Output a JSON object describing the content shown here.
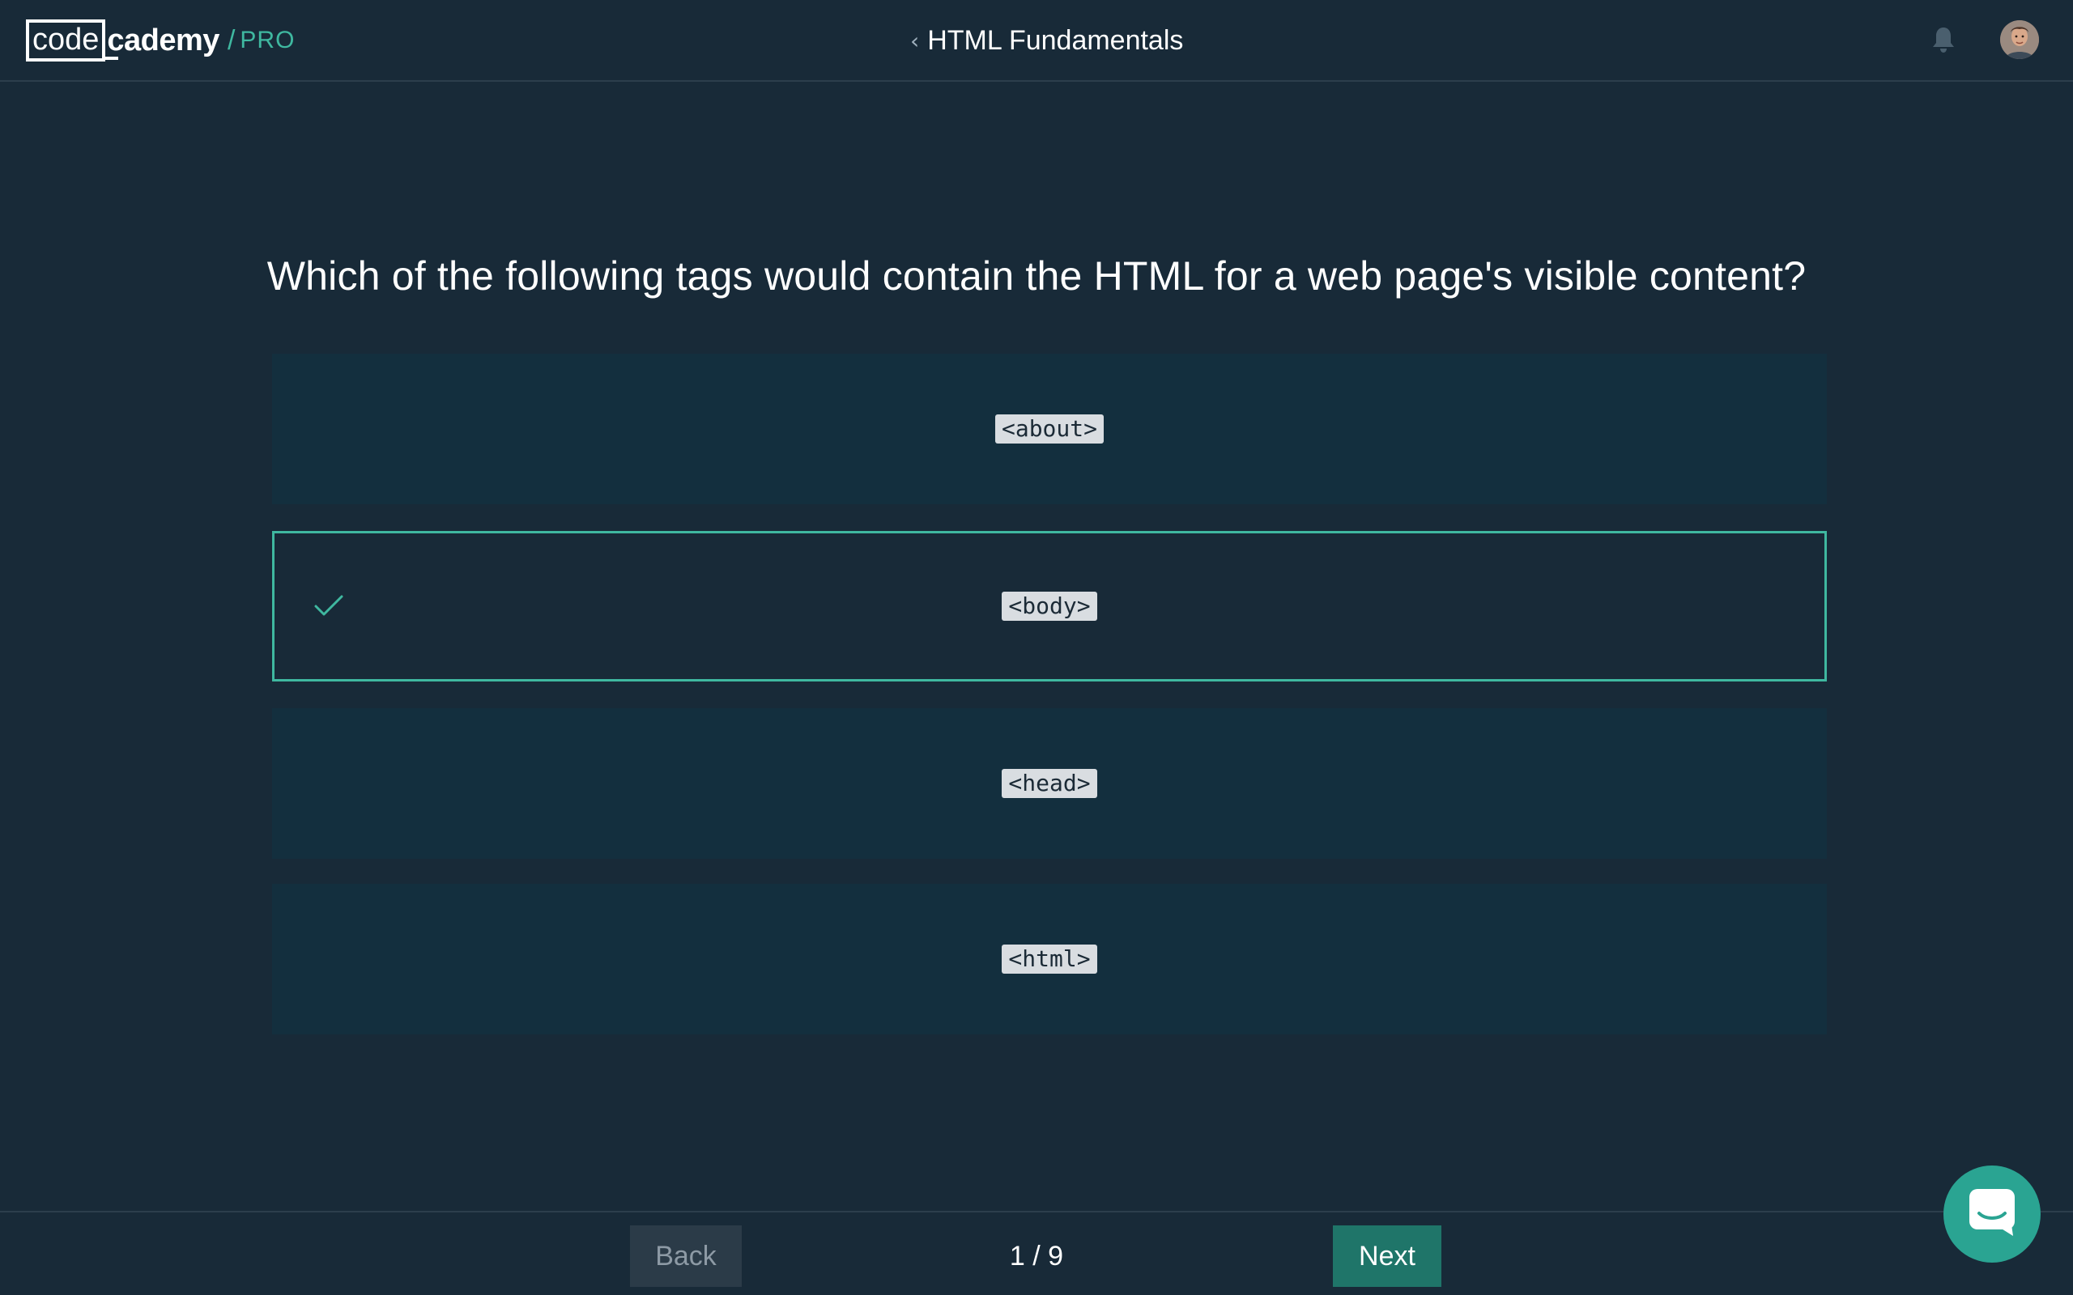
{
  "header": {
    "logo_code": "code",
    "logo_cademy": "cademy",
    "logo_separator": "/",
    "logo_pro": "PRO",
    "course_title": "HTML Fundamentals"
  },
  "quiz": {
    "question": "Which of the following tags would contain the HTML for a web page's visible content?",
    "options": [
      {
        "label": "<about>",
        "selected": false
      },
      {
        "label": "<body>",
        "selected": true
      },
      {
        "label": "<head>",
        "selected": false
      },
      {
        "label": "<html>",
        "selected": false
      }
    ]
  },
  "footer": {
    "back_label": "Back",
    "progress": "1 / 9",
    "next_label": "Next"
  },
  "icons": {
    "course_back": "chevron-left-icon",
    "notifications": "bell-icon",
    "avatar": "user-avatar",
    "selected_marker": "checkmark-icon",
    "chat": "chat-bubble-icon"
  },
  "colors": {
    "background": "#182a38",
    "option_background": "#132f3e",
    "accent": "#3fb8a0",
    "next_button": "#1f7569",
    "back_button": "#2b3b48",
    "chat_button": "#2aa492"
  }
}
